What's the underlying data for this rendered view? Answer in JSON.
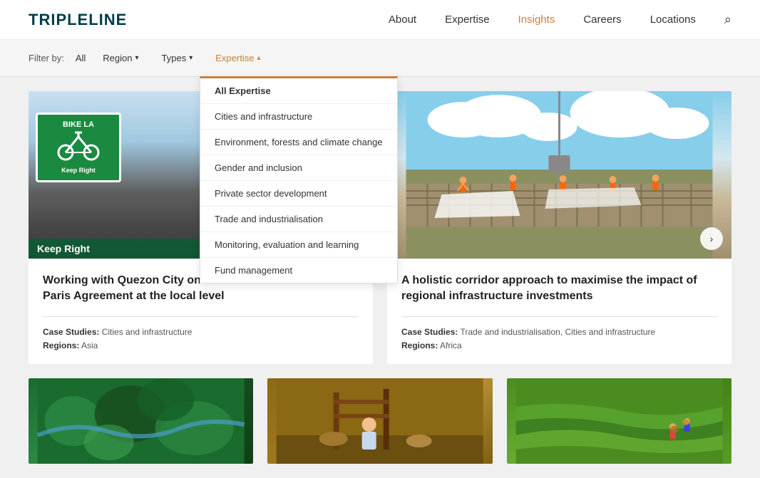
{
  "logo": "TRIPLELINE",
  "nav": {
    "items": [
      {
        "label": "About",
        "active": false
      },
      {
        "label": "Expertise",
        "active": false
      },
      {
        "label": "Insights",
        "active": true
      },
      {
        "label": "Careers",
        "active": false
      },
      {
        "label": "Locations",
        "active": false
      }
    ]
  },
  "filter": {
    "label": "Filter by:",
    "all_label": "All",
    "region_label": "Region",
    "types_label": "Types",
    "expertise_label": "Expertise"
  },
  "dropdown": {
    "items": [
      "All Expertise",
      "Cities and infrastructure",
      "Environment, forests and climate change",
      "Gender and inclusion",
      "Private sector development",
      "Trade and industrialisation",
      "Monitoring, evaluation and learning",
      "Fund management"
    ]
  },
  "cards": [
    {
      "title": "Working with Quezon City on its mission to deliver on the Paris Agreement at the local level",
      "case_studies_label": "Case Studies:",
      "case_studies_value": "Cities and infrastructure",
      "regions_label": "Regions:",
      "regions_value": "Asia"
    },
    {
      "title": "A holistic corridor approach to maximise the impact of regional infrastructure investments",
      "case_studies_label": "Case Studies:",
      "case_studies_value": "Trade and industrialisation,  Cities and infrastructure",
      "regions_label": "Regions:",
      "regions_value": "Africa"
    }
  ],
  "icons": {
    "search": "&#x2315;",
    "chevron_down": "&#x25BE;",
    "chevron_up": "&#x25B4;",
    "arrow_right": "&#x203A;"
  },
  "colors": {
    "accent": "#c8813a",
    "brand": "#003d4c",
    "active_nav": "#c8813a"
  }
}
